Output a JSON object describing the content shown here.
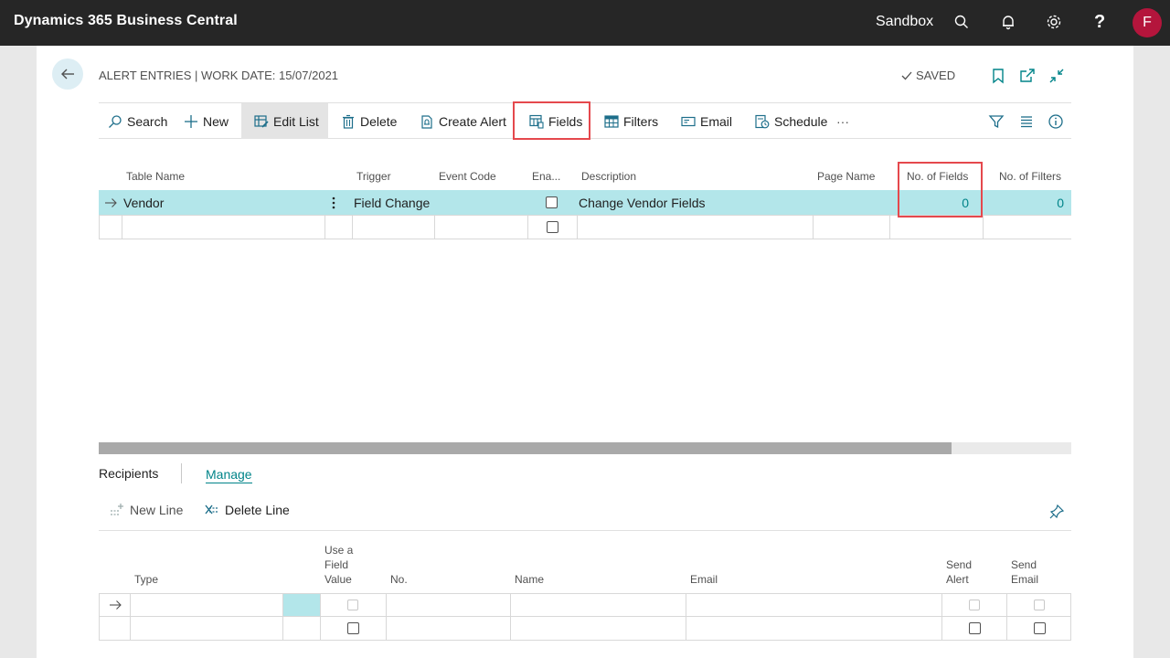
{
  "topbar": {
    "app_title": "Dynamics 365 Business Central",
    "company": "Sandbox",
    "help_glyph": "?",
    "avatar_initial": "F",
    "icons": [
      "search-icon",
      "bell-icon",
      "gear-icon",
      "help-icon"
    ]
  },
  "page": {
    "caption": "ALERT ENTRIES | WORK DATE: 15/07/2021",
    "saved_label": "SAVED",
    "header_icons": [
      "bookmark-icon",
      "open-new-window-icon",
      "collapse-icon"
    ]
  },
  "actions": {
    "search": "Search",
    "new": "New",
    "edit_list": "Edit List",
    "delete": "Delete",
    "create_alert": "Create Alert",
    "fields": "Fields",
    "filters": "Filters",
    "email": "Email",
    "schedule": "Schedule",
    "more": "···"
  },
  "grid": {
    "columns": [
      "Table Name",
      "Trigger",
      "Event Code",
      "Ena...",
      "Description",
      "Page Name",
      "No. of Fields",
      "No. of Filters"
    ],
    "rows": [
      {
        "table_name": "Vendor",
        "trigger": "Field Change",
        "event_code": "",
        "enabled": false,
        "description": "Change Vendor Fields",
        "page_name": "",
        "no_of_fields": "0",
        "no_of_filters": "0",
        "selected": true
      },
      {
        "table_name": "",
        "trigger": "",
        "event_code": "",
        "enabled": false,
        "description": "",
        "page_name": "",
        "no_of_fields": "",
        "no_of_filters": "",
        "selected": false
      }
    ]
  },
  "recipients": {
    "tab_recipients": "Recipients",
    "tab_manage": "Manage",
    "new_line": "New Line",
    "delete_line": "Delete Line",
    "columns": {
      "type": "Type",
      "use_field_value": "Use a Field Value",
      "no": "No.",
      "name": "Name",
      "email": "Email",
      "send_alert": "Send Alert",
      "send_email": "Send Email"
    }
  },
  "colors": {
    "topbar": "#262626",
    "accent": "#008489",
    "selected_row": "#b3e6ea",
    "highlight": "#e5484d",
    "avatar": "#b4153c"
  }
}
